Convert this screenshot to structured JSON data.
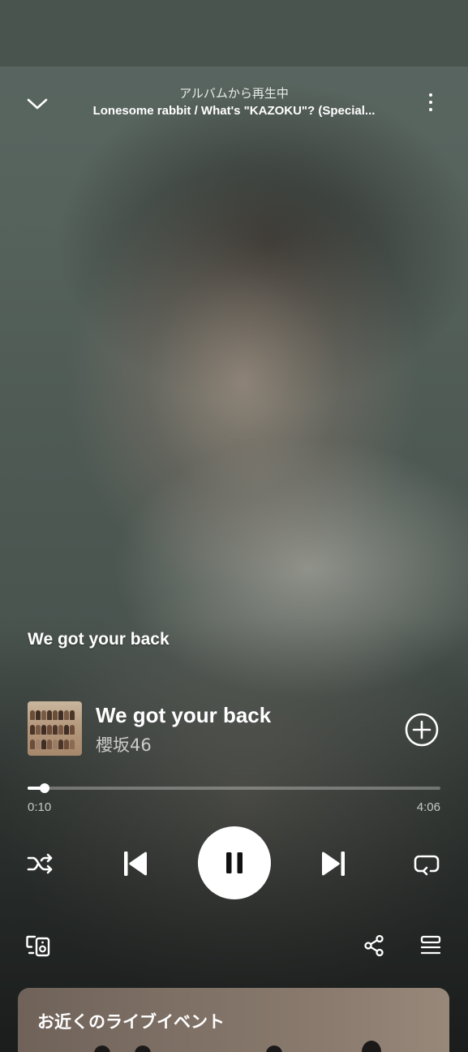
{
  "header": {
    "context": "アルバムから再生中",
    "album": "Lonesome rabbit / What's \"KAZOKU\"? (Special..."
  },
  "canvas": {
    "caption": "We got your back"
  },
  "track": {
    "title": "We got your back",
    "artist": "櫻坂46"
  },
  "playback": {
    "elapsed": "0:10",
    "total": "4:06",
    "progress_fraction": 0.041,
    "state": "playing"
  },
  "icons": {
    "collapse": "chevron-down-icon",
    "more": "more-vertical-icon",
    "add": "add-circle-icon",
    "shuffle": "shuffle-icon",
    "previous": "skip-previous-icon",
    "play_pause": "pause-icon",
    "next": "skip-next-icon",
    "repeat": "repeat-icon",
    "devices": "connect-device-icon",
    "share": "share-icon",
    "queue": "queue-icon"
  },
  "live_events": {
    "title": "お近くのライブイベント"
  },
  "colors": {
    "primary_text": "#ffffff",
    "secondary_text": "#b8bebb",
    "play_button": "#ffffff"
  }
}
